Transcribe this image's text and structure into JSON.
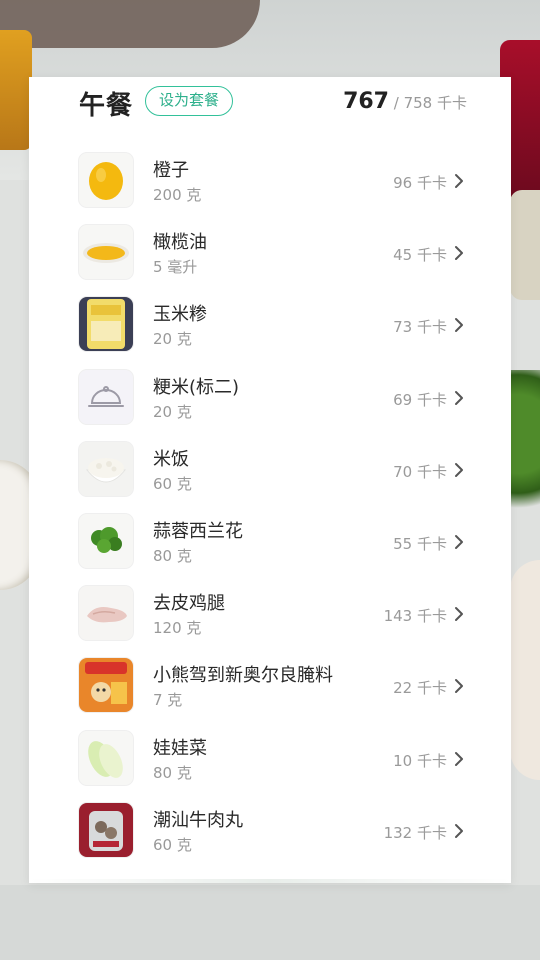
{
  "meal": {
    "title": "午餐",
    "set_button_label": "设为套餐",
    "consumed": "767",
    "target_text": " / 758 千卡"
  },
  "items": [
    {
      "name": "橙子",
      "amount": "200 克",
      "kcal": "96 千卡",
      "icon": "orange-photo"
    },
    {
      "name": "橄榄油",
      "amount": "5 毫升",
      "kcal": "45 千卡",
      "icon": "olive-oil-photo"
    },
    {
      "name": "玉米糁",
      "amount": "20 克",
      "kcal": "73 千卡",
      "icon": "corn-grits-package"
    },
    {
      "name": "粳米(标二)",
      "amount": "20 克",
      "kcal": "69 千卡",
      "icon": "food-cloche-placeholder-icon"
    },
    {
      "name": "米饭",
      "amount": "60 克",
      "kcal": "70 千卡",
      "icon": "rice-bowl-photo"
    },
    {
      "name": "蒜蓉西兰花",
      "amount": "80 克",
      "kcal": "55 千卡",
      "icon": "broccoli-photo"
    },
    {
      "name": "去皮鸡腿",
      "amount": "120 克",
      "kcal": "143 千卡",
      "icon": "chicken-leg-photo"
    },
    {
      "name": "小熊驾到新奥尔良腌料",
      "amount": "7 克",
      "kcal": "22 千卡",
      "icon": "marinade-package"
    },
    {
      "name": "娃娃菜",
      "amount": "80 克",
      "kcal": "10 千卡",
      "icon": "baby-cabbage-photo"
    },
    {
      "name": "潮汕牛肉丸",
      "amount": "60 克",
      "kcal": "132 千卡",
      "icon": "beef-ball-package"
    }
  ],
  "colors": {
    "accent": "#2eb08c",
    "text_primary": "#222222",
    "text_secondary": "#999999"
  }
}
